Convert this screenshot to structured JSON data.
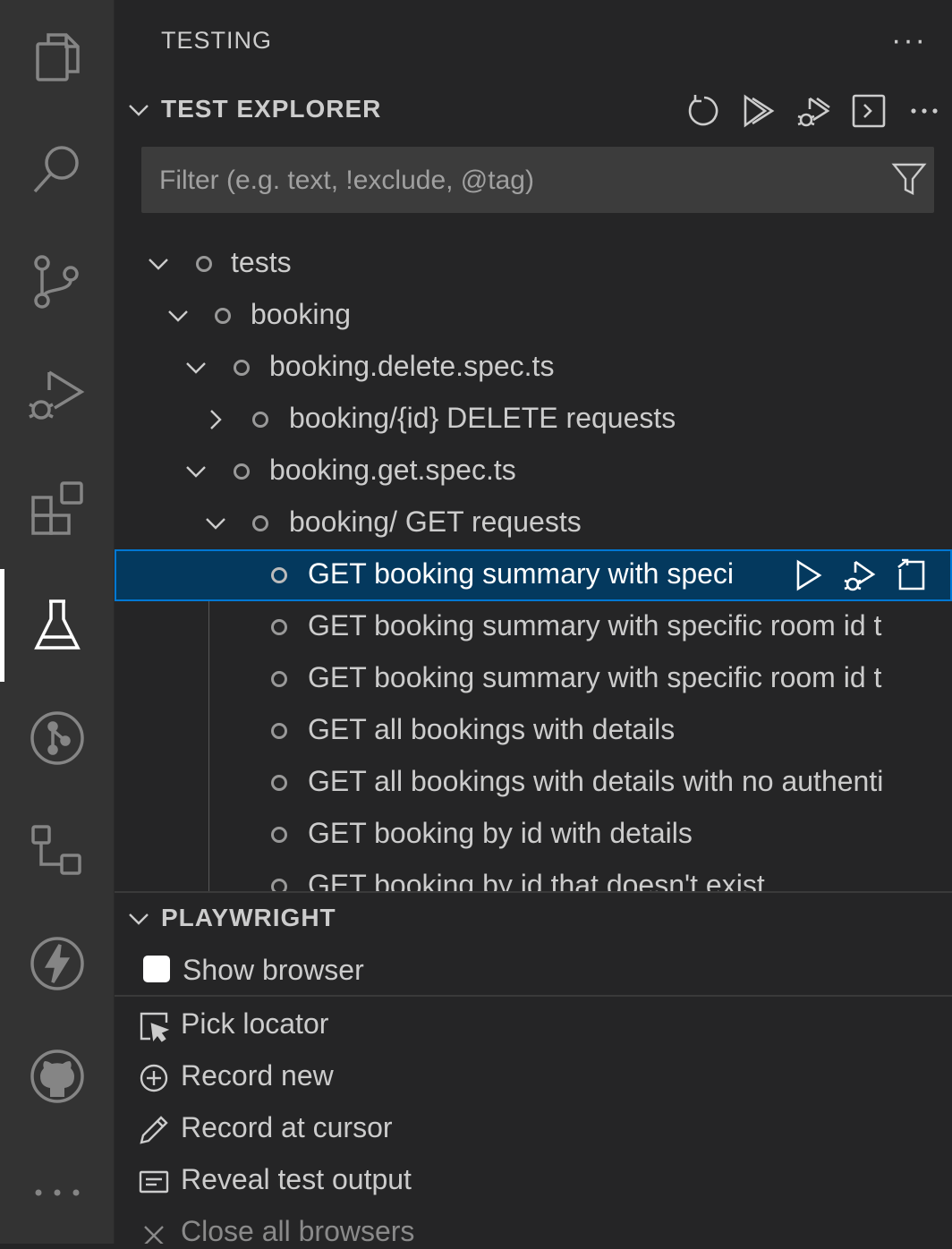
{
  "activity_bar": {
    "items": [
      "explorer-icon",
      "search-icon",
      "source-control-icon",
      "run-debug-icon",
      "extensions-icon",
      "testing-icon",
      "git-graph-icon",
      "remote-explorer-icon",
      "thunder-client-icon",
      "github-icon",
      "more-icon"
    ],
    "active": "testing-icon"
  },
  "sidebar": {
    "title": "TESTING",
    "more": "···"
  },
  "test_explorer": {
    "header": "TEST EXPLORER",
    "toolbar": [
      "refresh-icon",
      "run-all-icon",
      "debug-all-icon",
      "show-output-icon",
      "more-icon"
    ],
    "filter_placeholder": "Filter (e.g. text, !exclude, @tag)",
    "tree": [
      {
        "label": "tests",
        "expanded": true
      },
      {
        "label": "booking",
        "expanded": true
      },
      {
        "label": "booking.delete.spec.ts",
        "expanded": true
      },
      {
        "label": "booking/{id} DELETE requests",
        "expanded": false
      },
      {
        "label": "booking.get.spec.ts",
        "expanded": true
      },
      {
        "label": "booking/ GET requests",
        "expanded": true
      },
      {
        "label": "GET booking summary with speci",
        "selected": true
      },
      {
        "label": "GET booking summary with specific room id t"
      },
      {
        "label": "GET booking summary with specific room id t"
      },
      {
        "label": "GET all bookings with details"
      },
      {
        "label": "GET all bookings with details with no authenti"
      },
      {
        "label": "GET booking by id with details"
      },
      {
        "label": "GET booking by id that doesn't exist"
      }
    ],
    "selected_actions": [
      "run-test-icon",
      "debug-test-icon",
      "go-to-test-icon"
    ]
  },
  "playwright": {
    "header": "PLAYWRIGHT",
    "show_browser": {
      "label": "Show browser",
      "checked": false
    },
    "actions": [
      {
        "label": "Pick locator",
        "icon": "pick-locator-icon"
      },
      {
        "label": "Record new",
        "icon": "record-new-icon"
      },
      {
        "label": "Record at cursor",
        "icon": "record-at-cursor-icon"
      },
      {
        "label": "Reveal test output",
        "icon": "reveal-output-icon"
      },
      {
        "label": "Close all browsers",
        "icon": "close-icon",
        "disabled": true
      }
    ]
  }
}
